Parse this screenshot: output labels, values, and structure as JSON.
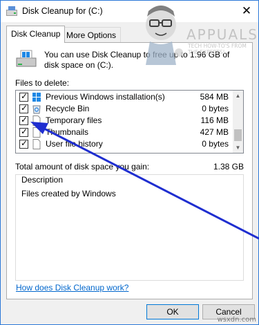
{
  "window": {
    "title": "Disk Cleanup for  (C:)",
    "close_glyph": "✕"
  },
  "tabs": [
    {
      "label": "Disk Cleanup",
      "active": true
    },
    {
      "label": "More Options",
      "active": false
    }
  ],
  "intro_text": "You can use Disk Cleanup to free up to 1.96 GB of disk space on  (C:).",
  "files_label": "Files to delete:",
  "files": [
    {
      "name": "Previous Windows installation(s)",
      "size": "584 MB",
      "checked": true,
      "icon": "windows-logo-icon"
    },
    {
      "name": "Recycle Bin",
      "size": "0 bytes",
      "checked": true,
      "icon": "recycle-bin-icon"
    },
    {
      "name": "Temporary files",
      "size": "116 MB",
      "checked": true,
      "icon": "document-icon"
    },
    {
      "name": "Thumbnails",
      "size": "427 MB",
      "checked": true,
      "icon": "document-icon"
    },
    {
      "name": "User file history",
      "size": "0 bytes",
      "checked": true,
      "icon": "document-icon"
    }
  ],
  "total_label": "Total amount of disk space you gain:",
  "total_value": "1.38 GB",
  "description": {
    "legend": "Description",
    "text": "Files created by Windows"
  },
  "help_link": "How does Disk Cleanup work?",
  "buttons": {
    "ok": "OK",
    "cancel": "Cancel"
  },
  "branding": {
    "logo_text": "APPUALS",
    "logo_tagline": "TECH HOW-TO'S FROM THE EXPERTS!",
    "watermark": "wsxdn.com"
  },
  "colors": {
    "accent": "#2b78d8",
    "annotation_arrow": "#1f2ed0",
    "link": "#0066cc"
  }
}
